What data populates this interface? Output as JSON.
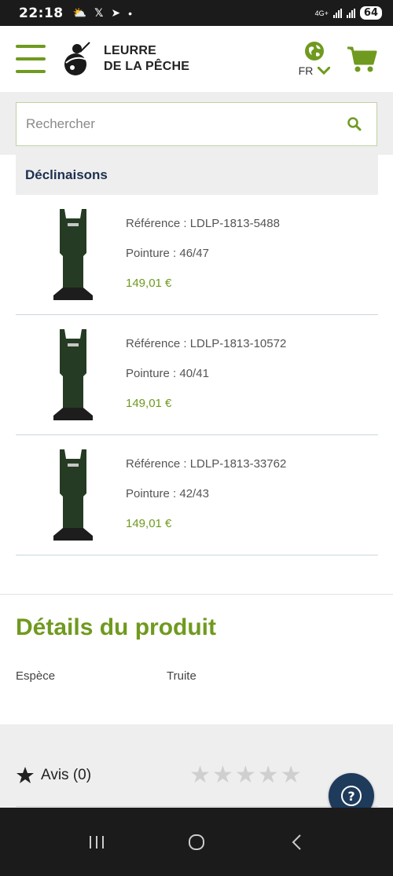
{
  "status_bar": {
    "time": "22:18",
    "icons": [
      "weather-icon",
      "x-icon",
      "telegram-icon",
      "dot-icon"
    ],
    "network_label": "4G+",
    "battery": "64"
  },
  "header": {
    "logo_line1": "LEURRE",
    "logo_line2": "DE LA PÊCHE",
    "language": "FR",
    "accent_color": "#6f9a1f"
  },
  "search": {
    "placeholder": "Rechercher"
  },
  "variants_section": {
    "title": "Déclinaisons",
    "items": [
      {
        "reference": "Référence : LDLP-1813-5488",
        "size": "Pointure : 46/47",
        "price": "149,01 €"
      },
      {
        "reference": "Référence : LDLP-1813-10572",
        "size": "Pointure : 40/41",
        "price": "149,01 €"
      },
      {
        "reference": "Référence : LDLP-1813-33762",
        "size": "Pointure : 42/43",
        "price": "149,01 €"
      }
    ]
  },
  "details": {
    "title": "Détails du produit",
    "rows": [
      {
        "key": "Espèce",
        "value": "Truite"
      }
    ]
  },
  "reviews": {
    "label": "Avis (0)",
    "rating": 0,
    "max_rating": 5
  },
  "help_button": {
    "symbol": "?"
  }
}
